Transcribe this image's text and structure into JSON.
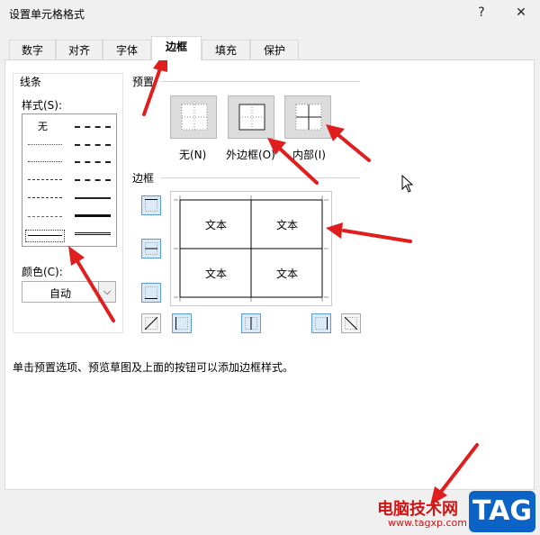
{
  "dialog": {
    "title": "设置单元格格式",
    "help": "?",
    "close": "✕"
  },
  "tabs": [
    "数字",
    "对齐",
    "字体",
    "边框",
    "填充",
    "保护"
  ],
  "line_section": {
    "label": "线条",
    "style_label": "样式(S):",
    "none_label": "无",
    "color_label": "颜色(C):",
    "color_value": "自动"
  },
  "preset_section": {
    "label": "预置",
    "buttons": [
      {
        "name": "none",
        "label": "无(N)"
      },
      {
        "name": "outline",
        "label": "外边框(O)"
      },
      {
        "name": "inside",
        "label": "内部(I)"
      }
    ]
  },
  "border_section": {
    "label": "边框",
    "cells": [
      "文本",
      "文本",
      "文本",
      "文本"
    ]
  },
  "note": "单击预置选项、预览草图及上面的按钮可以添加边框样式。",
  "watermark": {
    "text": "电脑技术网",
    "url": "www.tagxp.com",
    "logo": "TAG"
  },
  "colors": {
    "arrow": "#e01e1e",
    "active_button": "#dbeaf9",
    "logo_bg": "#0b63c5",
    "watermark_text": "#d11414"
  }
}
